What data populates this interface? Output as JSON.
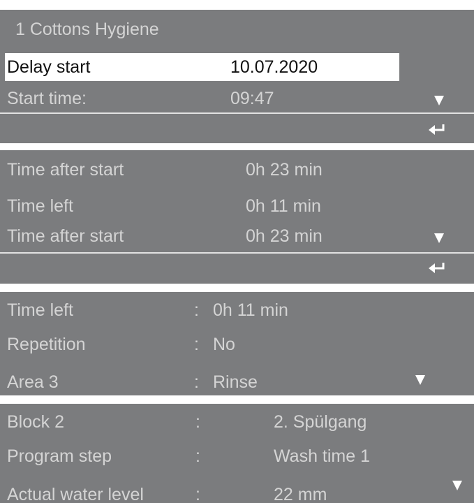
{
  "screen1": {
    "header": "1   Cottons Hygiene",
    "delay_label": "Delay start",
    "delay_value": "10.07.2020",
    "start_label": "Start time:",
    "start_value": "09:47"
  },
  "screen2": {
    "rows": [
      {
        "label": "Time after start",
        "value": "0h 23 min"
      },
      {
        "label": "Time left",
        "value": "0h 11 min"
      },
      {
        "label": "Time after start",
        "value": "0h 23 min"
      }
    ]
  },
  "screen3": {
    "rows": [
      {
        "label": "Time left",
        "sep": ":",
        "value": "0h 11 min"
      },
      {
        "label": "Repetition",
        "sep": ":",
        "value": "No"
      },
      {
        "label": "Area 3",
        "sep": ":",
        "value": "Rinse"
      }
    ]
  },
  "screen4": {
    "rows": [
      {
        "label": "Block   2",
        "sep": ":",
        "value": "2. Spülgang"
      },
      {
        "label": "Program step",
        "sep": ":",
        "value": "Wash time 1"
      },
      {
        "label": "Actual water level",
        "sep": ":",
        "value": "22 mm"
      }
    ]
  },
  "icons": {
    "scroll_down": "triangle-down-icon",
    "enter": "return-arrow-icon"
  },
  "colors": {
    "panel": "#7b7c7e",
    "text": "#d4d4d4",
    "highlight": "#ffffff"
  }
}
